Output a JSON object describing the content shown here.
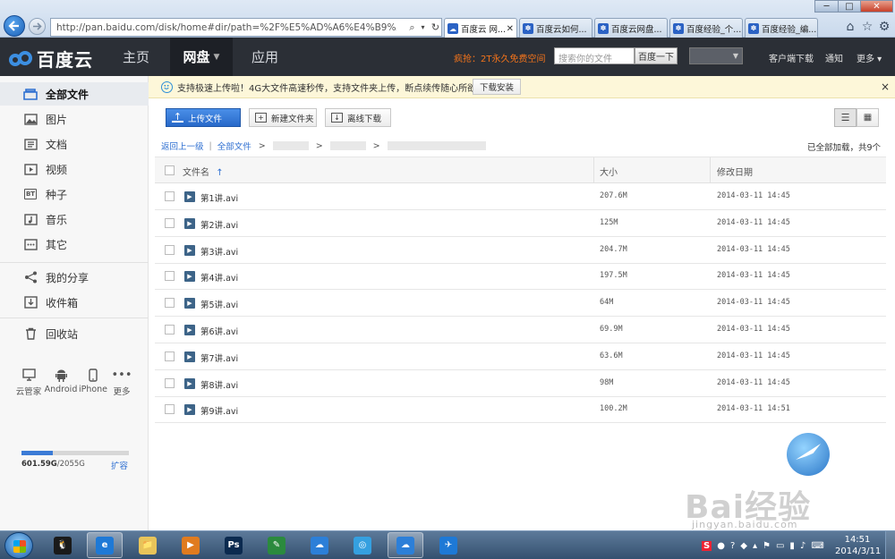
{
  "browser": {
    "address": "http://pan.baidu.com/disk/home#dir/path=%2F%E5%AD%A6%E4%B9%A0%E8%B5",
    "address_host": "pan.baidu.com",
    "tabs": [
      {
        "label": "百度云 网...",
        "active": true
      },
      {
        "label": "百度云如何..."
      },
      {
        "label": "百度云网盘..."
      },
      {
        "label": "百度经验_个..."
      },
      {
        "label": "百度经验_编..."
      }
    ]
  },
  "header": {
    "logo_text": "百度云",
    "nav": {
      "home": "主页",
      "disk": "网盘",
      "apps": "应用"
    },
    "promo": "疯抢：2T永久免费空间",
    "search_placeholder": "搜索你的文件",
    "search_button": "百度一下",
    "links": {
      "client": "客户端下载",
      "notice": "通知",
      "more": "更多"
    }
  },
  "sidebar": {
    "items": [
      {
        "label": "全部文件",
        "icon": "folder-icon"
      },
      {
        "label": "图片",
        "icon": "image-icon"
      },
      {
        "label": "文档",
        "icon": "document-icon"
      },
      {
        "label": "视频",
        "icon": "video-icon"
      },
      {
        "label": "种子",
        "icon": "bt-icon",
        "glyph": "BT"
      },
      {
        "label": "音乐",
        "icon": "music-icon"
      },
      {
        "label": "其它",
        "icon": "other-icon"
      },
      {
        "label": "我的分享",
        "icon": "share-icon"
      },
      {
        "label": "收件箱",
        "icon": "inbox-icon"
      },
      {
        "label": "回收站",
        "icon": "trash-icon"
      }
    ],
    "devices": [
      {
        "label": "云管家",
        "icon": "pc-icon"
      },
      {
        "label": "Android",
        "icon": "android-icon"
      },
      {
        "label": "iPhone",
        "icon": "iphone-icon"
      },
      {
        "label": "更多",
        "icon": "more-dots-icon"
      }
    ],
    "quota": {
      "used": "601.59G",
      "total": "/2055G",
      "expand": "扩容",
      "used_fraction": 0.29
    }
  },
  "notice": {
    "text": "支持极速上传啦！4G大文件高速秒传，支持文件夹上传，断点续传随心所欲！",
    "button": "下载安装",
    "close": "×"
  },
  "toolbar": {
    "upload": "上传文件",
    "new_folder": "新建文件夹",
    "offline": "离线下载"
  },
  "breadcrumb": {
    "back": "返回上一级",
    "root": "全部文件"
  },
  "status": "已全部加载，共9个",
  "table": {
    "headers": {
      "name": "文件名",
      "size": "大小",
      "date": "修改日期"
    },
    "rows": [
      {
        "name": "第1讲.avi",
        "size": "207.6M",
        "date": "2014-03-11 14:45"
      },
      {
        "name": "第2讲.avi",
        "size": "125M",
        "date": "2014-03-11 14:45"
      },
      {
        "name": "第3讲.avi",
        "size": "204.7M",
        "date": "2014-03-11 14:45"
      },
      {
        "name": "第4讲.avi",
        "size": "197.5M",
        "date": "2014-03-11 14:45"
      },
      {
        "name": "第5讲.avi",
        "size": "64M",
        "date": "2014-03-11 14:45"
      },
      {
        "name": "第6讲.avi",
        "size": "69.9M",
        "date": "2014-03-11 14:45"
      },
      {
        "name": "第7讲.avi",
        "size": "63.6M",
        "date": "2014-03-11 14:45"
      },
      {
        "name": "第8讲.avi",
        "size": "98M",
        "date": "2014-03-11 14:45"
      },
      {
        "name": "第9讲.avi",
        "size": "100.2M",
        "date": "2014-03-11 14:51"
      }
    ]
  },
  "watermark": {
    "logo": "Bai经验",
    "url": "jingyan.baidu.com"
  },
  "taskbar": {
    "apps": [
      {
        "name": "qq-icon",
        "glyph": "🐧"
      },
      {
        "name": "ie-icon",
        "glyph": "e",
        "open": true
      },
      {
        "name": "explorer-icon",
        "glyph": "📁"
      },
      {
        "name": "media-player-icon",
        "glyph": "▶"
      },
      {
        "name": "photoshop-icon",
        "glyph": "Ps"
      },
      {
        "name": "fetion-icon",
        "glyph": "✎"
      },
      {
        "name": "baidu-cloud-icon",
        "glyph": "☁"
      },
      {
        "name": "cloud-sync-icon",
        "glyph": "◎"
      },
      {
        "name": "baidu-cloud-manager-icon",
        "glyph": "☁",
        "open": true
      },
      {
        "name": "bird-app-icon",
        "glyph": "✈"
      }
    ],
    "time": "14:51",
    "date": "2014/3/11"
  }
}
